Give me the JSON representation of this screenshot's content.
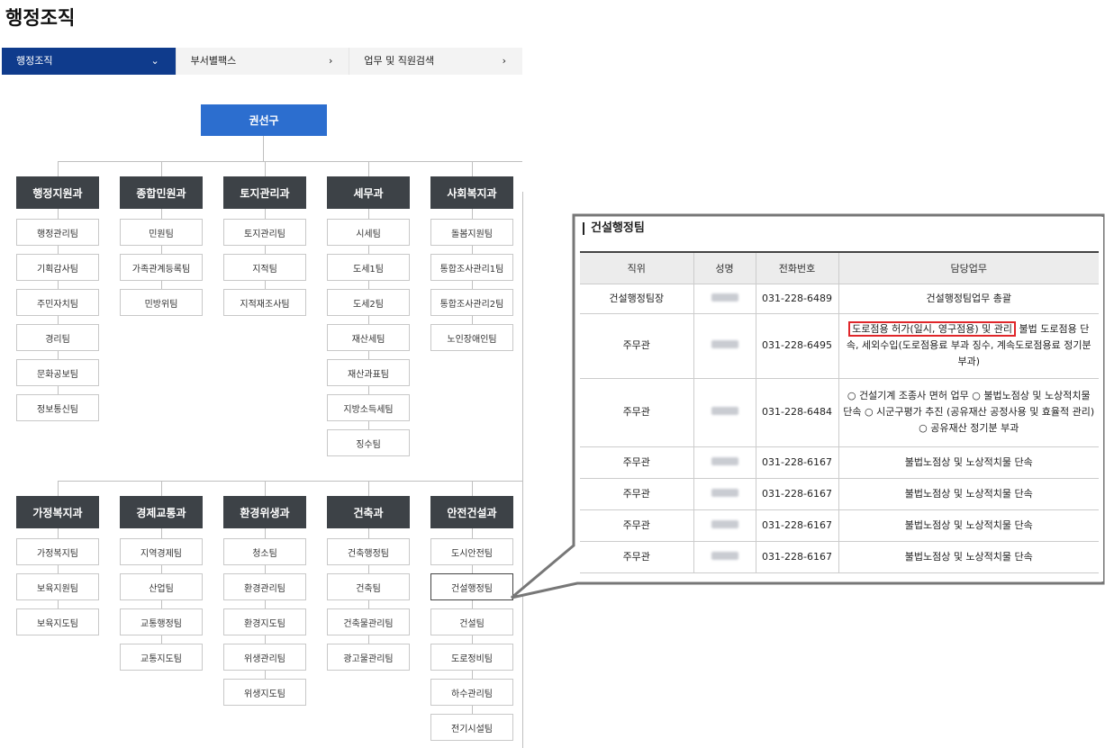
{
  "page": {
    "title": "행정조직"
  },
  "tabs": [
    {
      "label": "행정조직",
      "chevron": "⌄"
    },
    {
      "label": "부서별팩스",
      "chevron": "›"
    },
    {
      "label": "업무 및 직원검색",
      "chevron": "›"
    }
  ],
  "org": {
    "root": "권선구",
    "row1": [
      {
        "name": "행정지원과",
        "teams": [
          "행정관리팀",
          "기획감사팀",
          "주민자치팀",
          "경리팀",
          "문화공보팀",
          "정보통신팀"
        ]
      },
      {
        "name": "종합민원과",
        "teams": [
          "민원팀",
          "가족관계등록팀",
          "민방위팀"
        ]
      },
      {
        "name": "토지관리과",
        "teams": [
          "토지관리팀",
          "지적팀",
          "지적재조사팀"
        ]
      },
      {
        "name": "세무과",
        "teams": [
          "시세팀",
          "도세1팀",
          "도세2팀",
          "재산세팀",
          "재산과표팀",
          "지방소득세팀",
          "징수팀"
        ]
      },
      {
        "name": "사회복지과",
        "teams": [
          "돌봄지원팀",
          "통합조사관리1팀",
          "통합조사관리2팀",
          "노인장애인팀"
        ]
      }
    ],
    "row2": [
      {
        "name": "가정복지과",
        "teams": [
          "가정복지팀",
          "보육지원팀",
          "보육지도팀"
        ]
      },
      {
        "name": "경제교통과",
        "teams": [
          "지역경제팀",
          "산업팀",
          "교통행정팀",
          "교통지도팀"
        ]
      },
      {
        "name": "환경위생과",
        "teams": [
          "청소팀",
          "환경관리팀",
          "환경지도팀",
          "위생관리팀",
          "위생지도팀"
        ]
      },
      {
        "name": "건축과",
        "teams": [
          "건축행정팀",
          "건축팀",
          "건축물관리팀",
          "광고물관리팀"
        ]
      },
      {
        "name": "안전건설과",
        "teams": [
          "도시안전팀",
          "건설행정팀",
          "건설팀",
          "도로정비팀",
          "하수관리팀",
          "전기시설팀"
        ]
      }
    ]
  },
  "detail": {
    "title": "건설행정팀",
    "headers": [
      "직위",
      "성명",
      "전화번호",
      "담당업무"
    ],
    "rows": [
      {
        "position": "건설행정팀장",
        "phone": "031-228-6489",
        "duty": "건설행정팀업무 총괄"
      },
      {
        "position": "주무관",
        "phone": "031-228-6495",
        "duty_highlight": "도로점용 허가(일시, 영구점용) 및 관리",
        "duty": " 불법 도로점용 단속, 세외수입(도로점용료 부과 징수, 계속도로점용료 정기분 부과)"
      },
      {
        "position": "주무관",
        "phone": "031-228-6484",
        "duty": "○ 건설기계 조종사 면허 업무 ○ 불법노점상 및 노상적치물 단속 ○ 시군구평가 추진 (공유재산 공정사용 및 효율적 관리) ○ 공유재산 정기분 부과"
      },
      {
        "position": "주무관",
        "phone": "031-228-6167",
        "duty": "불법노점상 및 노상적치물 단속"
      },
      {
        "position": "주무관",
        "phone": "031-228-6167",
        "duty": "불법노점상 및 노상적치물 단속"
      },
      {
        "position": "주무관",
        "phone": "031-228-6167",
        "duty": "불법노점상 및 노상적치물 단속"
      },
      {
        "position": "주무관",
        "phone": "031-228-6167",
        "duty": "불법노점상 및 노상적치물 단속"
      }
    ]
  },
  "colors": {
    "root": "#2c6ecf",
    "dept": "#3d4247",
    "tab_active": "#0f3b8c",
    "highlight_box": "#e0262a"
  }
}
